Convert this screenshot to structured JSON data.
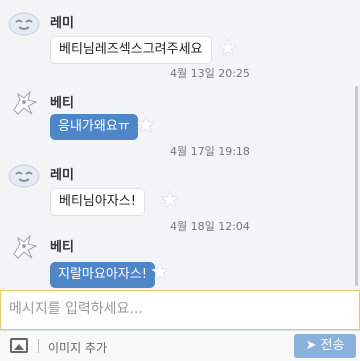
{
  "messages": [
    {
      "sender": "레미",
      "text": "베티님레즈섹스그려주세요",
      "time": "4월 13일 20:25",
      "style": "white"
    },
    {
      "sender": "베티",
      "text": "응내가왜요ㅠ",
      "time": "4월 17일 19:18",
      "style": "blue"
    },
    {
      "sender": "레미",
      "text": "베티님아자스!",
      "time": "4월 18일 12:04",
      "style": "white"
    },
    {
      "sender": "베티",
      "text": "지랄마요아자스!",
      "time": "",
      "style": "blue"
    }
  ],
  "composer": {
    "placeholder": "메시지를 입력하세요..."
  },
  "toolbar": {
    "add_image_label": "이미지 추가",
    "send_label": "전송"
  },
  "colors": {
    "blue_bubble": "#4e86c8",
    "send_button": "#8ab0dc",
    "input_border": "#e6c96a"
  }
}
